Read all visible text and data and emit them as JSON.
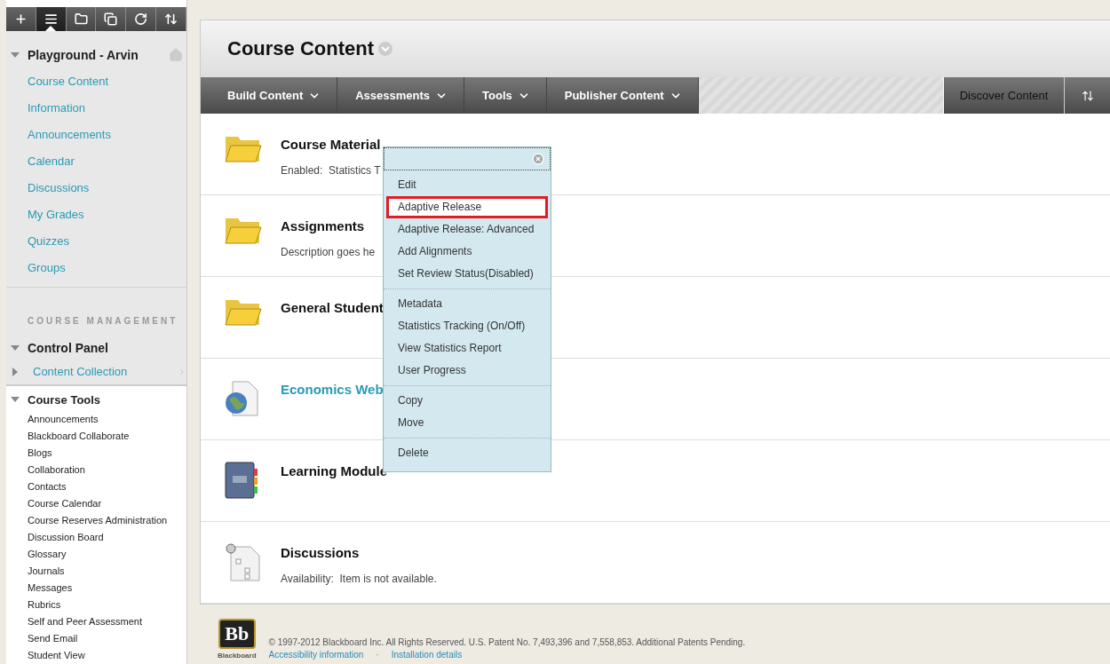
{
  "toolbar_buttons": [
    {
      "kind": "add",
      "selected": false
    },
    {
      "kind": "list",
      "selected": true
    },
    {
      "kind": "folder",
      "selected": false
    },
    {
      "kind": "window",
      "selected": false
    },
    {
      "kind": "refresh",
      "selected": false
    },
    {
      "kind": "sort",
      "selected": false
    }
  ],
  "sidebar": {
    "course": {
      "title": "Playground - Arvin",
      "expanded": true,
      "items": [
        {
          "label": "Course Content"
        },
        {
          "label": "Information"
        },
        {
          "label": "Announcements"
        },
        {
          "label": "Calendar"
        },
        {
          "label": "Discussions"
        },
        {
          "label": "My Grades"
        },
        {
          "label": "Quizzes"
        },
        {
          "label": "Groups"
        }
      ]
    },
    "section_heading": "COURSE MANAGEMENT",
    "control_panel": {
      "title": "Control Panel",
      "expanded": true,
      "items": [
        {
          "label": "Content Collection",
          "expanded": false
        }
      ]
    },
    "course_tools": {
      "title": "Course Tools",
      "expanded": true,
      "items": [
        {
          "label": "Announcements"
        },
        {
          "label": "Blackboard Collaborate"
        },
        {
          "label": "Blogs"
        },
        {
          "label": "Collaboration"
        },
        {
          "label": "Contacts"
        },
        {
          "label": "Course Calendar"
        },
        {
          "label": "Course Reserves Administration"
        },
        {
          "label": "Discussion Board"
        },
        {
          "label": "Glossary"
        },
        {
          "label": "Journals"
        },
        {
          "label": "Messages"
        },
        {
          "label": "Rubrics"
        },
        {
          "label": "Self and Peer Assessment"
        },
        {
          "label": "Send Email"
        },
        {
          "label": "Student View"
        }
      ]
    }
  },
  "page": {
    "title": "Course Content",
    "action_menus": [
      {
        "label": "Build Content"
      },
      {
        "label": "Assessments"
      },
      {
        "label": "Tools"
      },
      {
        "label": "Publisher Content"
      }
    ],
    "discover_button": "Discover Content",
    "items": [
      {
        "kind": "folder",
        "title": "Course Material",
        "detail": "Enabled:  Statistics T"
      },
      {
        "kind": "folder",
        "title": "Assignments",
        "detail": "Description goes he"
      },
      {
        "kind": "folder",
        "title": "General Student"
      },
      {
        "kind": "link",
        "title": "Economics Web"
      },
      {
        "kind": "module",
        "title": "Learning Module"
      },
      {
        "kind": "discussion",
        "title": "Discussions",
        "detail": "Availability:  Item is not available."
      }
    ]
  },
  "context_menu": {
    "groups": [
      [
        {
          "label": "Edit",
          "selected": false
        },
        {
          "label": "Adaptive Release",
          "selected": true
        },
        {
          "label": "Adaptive Release: Advanced",
          "selected": false
        },
        {
          "label": "Add Alignments",
          "selected": false
        },
        {
          "label": "Set Review Status(Disabled)",
          "selected": false
        }
      ],
      [
        {
          "label": "Metadata",
          "selected": false
        },
        {
          "label": "Statistics Tracking (On/Off)",
          "selected": false
        },
        {
          "label": "View Statistics Report",
          "selected": false
        },
        {
          "label": "User Progress",
          "selected": false
        }
      ],
      [
        {
          "label": "Copy",
          "selected": false
        },
        {
          "label": "Move",
          "selected": false
        }
      ],
      [
        {
          "label": "Delete",
          "selected": false
        }
      ]
    ]
  },
  "footer": {
    "logo_mark": "Bb",
    "logo_name": "Blackboard",
    "copyright": "© 1997-2012 Blackboard Inc. All Rights Reserved. U.S. Patent No. 7,493,396 and 7,558,853. Additional Patents Pending.",
    "links": [
      "Accessibility information",
      "Installation details"
    ],
    "separator": "·"
  }
}
